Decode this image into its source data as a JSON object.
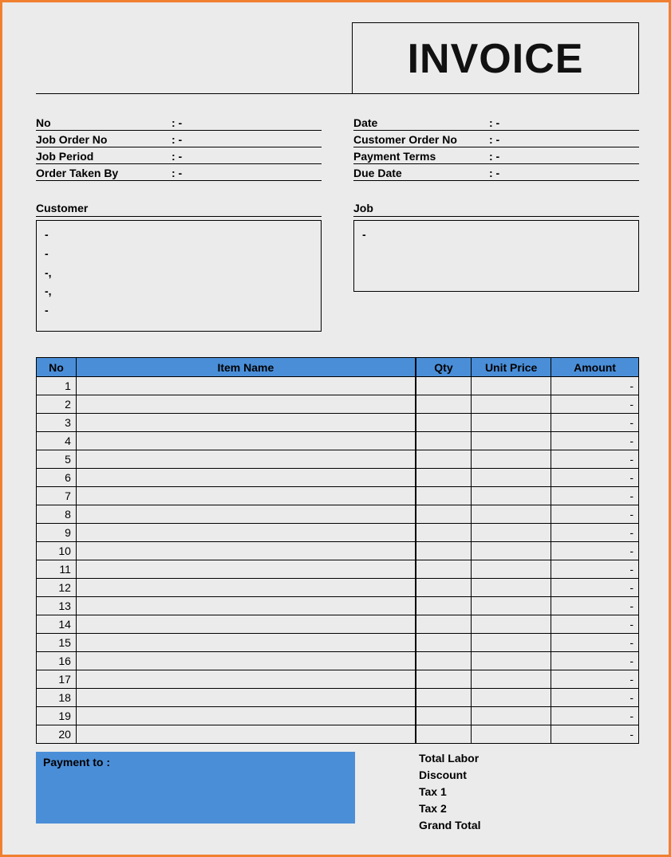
{
  "title": "INVOICE",
  "info_left": {
    "no": {
      "label": "No",
      "value": ": -"
    },
    "job_order_no": {
      "label": "Job Order No",
      "value": ": -"
    },
    "job_period": {
      "label": "Job Period",
      "value": ": -"
    },
    "order_taken_by": {
      "label": "Order Taken By",
      "value": ": -"
    }
  },
  "info_right": {
    "date": {
      "label": "Date",
      "value": ": -"
    },
    "customer_order_no": {
      "label": "Customer Order No",
      "value": ": -"
    },
    "payment_terms": {
      "label": "Payment  Terms",
      "value": ": -"
    },
    "due_date": {
      "label": "Due Date",
      "value": ": -"
    }
  },
  "customer": {
    "label": "Customer",
    "lines": [
      "-",
      "-",
      "-,",
      "-,",
      "-"
    ]
  },
  "job": {
    "label": "Job",
    "lines": [
      "-"
    ]
  },
  "items": {
    "headers": {
      "no": "No",
      "item": "Item Name",
      "qty": "Qty",
      "price": "Unit Price",
      "amount": "Amount"
    },
    "rows": [
      {
        "no": "1",
        "item": "",
        "qty": "",
        "price": "",
        "amount": "-"
      },
      {
        "no": "2",
        "item": "",
        "qty": "",
        "price": "",
        "amount": "-"
      },
      {
        "no": "3",
        "item": "",
        "qty": "",
        "price": "",
        "amount": "-"
      },
      {
        "no": "4",
        "item": "",
        "qty": "",
        "price": "",
        "amount": "-"
      },
      {
        "no": "5",
        "item": "",
        "qty": "",
        "price": "",
        "amount": "-"
      },
      {
        "no": "6",
        "item": "",
        "qty": "",
        "price": "",
        "amount": "-"
      },
      {
        "no": "7",
        "item": "",
        "qty": "",
        "price": "",
        "amount": "-"
      },
      {
        "no": "8",
        "item": "",
        "qty": "",
        "price": "",
        "amount": "-"
      },
      {
        "no": "9",
        "item": "",
        "qty": "",
        "price": "",
        "amount": "-"
      },
      {
        "no": "10",
        "item": "",
        "qty": "",
        "price": "",
        "amount": "-"
      },
      {
        "no": "11",
        "item": "",
        "qty": "",
        "price": "",
        "amount": "-"
      },
      {
        "no": "12",
        "item": "",
        "qty": "",
        "price": "",
        "amount": "-"
      },
      {
        "no": "13",
        "item": "",
        "qty": "",
        "price": "",
        "amount": "-"
      },
      {
        "no": "14",
        "item": "",
        "qty": "",
        "price": "",
        "amount": "-"
      },
      {
        "no": "15",
        "item": "",
        "qty": "",
        "price": "",
        "amount": "-"
      },
      {
        "no": "16",
        "item": "",
        "qty": "",
        "price": "",
        "amount": "-"
      },
      {
        "no": "17",
        "item": "",
        "qty": "",
        "price": "",
        "amount": "-"
      },
      {
        "no": "18",
        "item": "",
        "qty": "",
        "price": "",
        "amount": "-"
      },
      {
        "no": "19",
        "item": "",
        "qty": "",
        "price": "",
        "amount": "-"
      },
      {
        "no": "20",
        "item": "",
        "qty": "",
        "price": "",
        "amount": "-"
      }
    ]
  },
  "payment_to_label": "Payment to :",
  "totals": {
    "total_labor": {
      "label": "Total Labor",
      "value": ""
    },
    "discount": {
      "label": "Discount",
      "value": ""
    },
    "tax1": {
      "label": "Tax 1",
      "value": ""
    },
    "tax2": {
      "label": "Tax 2",
      "value": ""
    },
    "grand_total": {
      "label": "Grand Total",
      "value": ""
    }
  }
}
